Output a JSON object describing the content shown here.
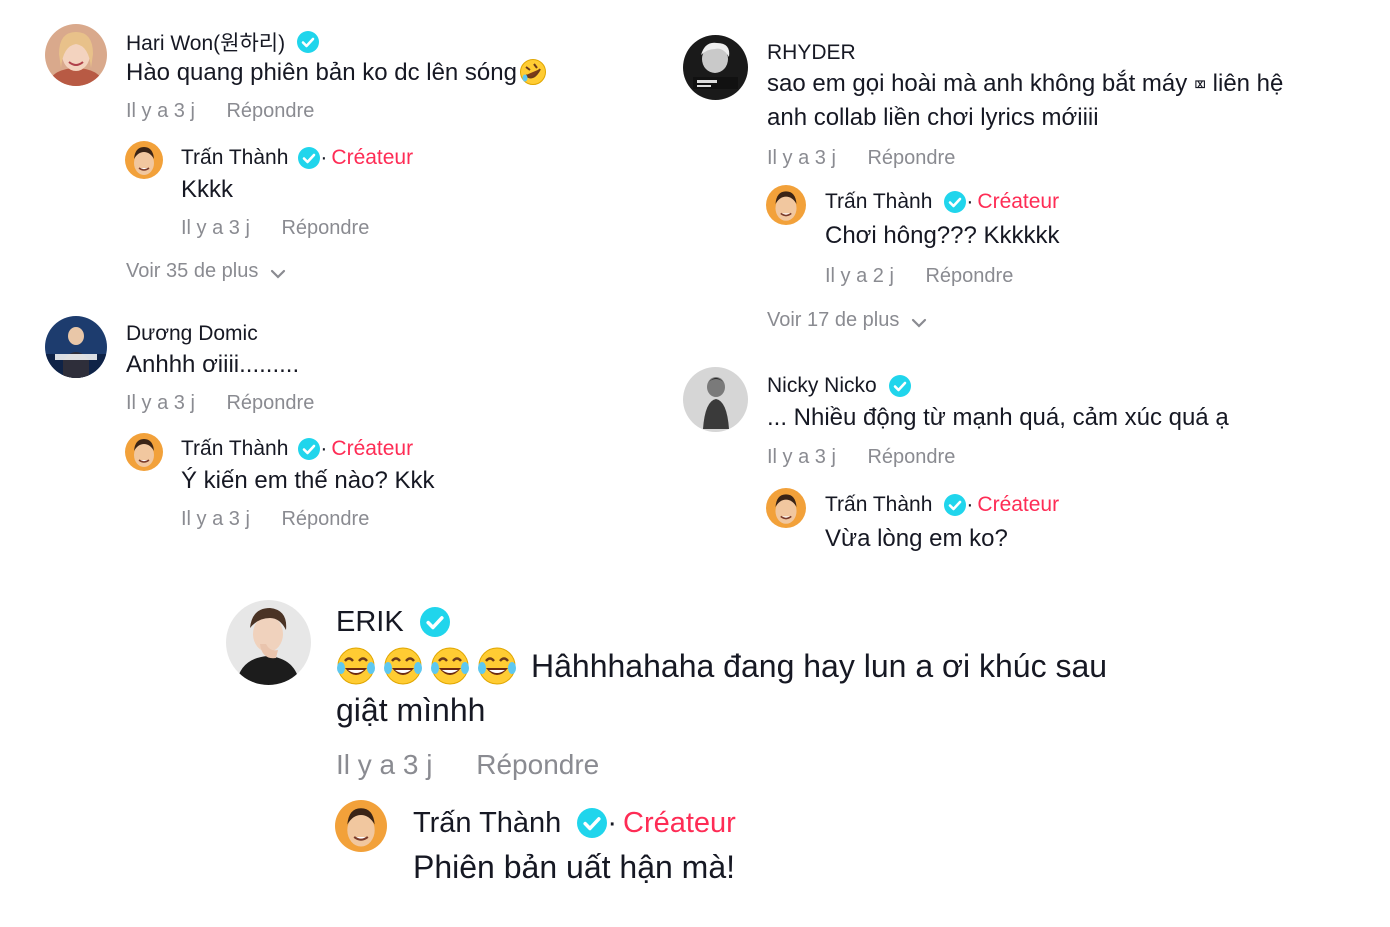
{
  "labels": {
    "creator": "Créateur",
    "reply": "Répondre",
    "dot": "·"
  },
  "colors": {
    "creator": "#fe2c55",
    "verified": "#20d5ec",
    "meta": "#8a8b91",
    "text": "#161823"
  },
  "left": {
    "c1": {
      "author": "Hari Won(원하리)",
      "verified": true,
      "text": "Hào quang phiên bản ko dc lên sóng",
      "emoji": "rolling-on-floor-laughing",
      "time": "Il y a 3 j",
      "reply": {
        "author": "Trấn Thành",
        "text": "Kkkk",
        "time": "Il y a 3 j"
      },
      "more": "Voir 35 de plus"
    },
    "c2": {
      "author": "Dương Domic",
      "verified": false,
      "text": "Anhhh ơiiii.........",
      "time": "Il y a 3 j",
      "reply": {
        "author": "Trấn Thành",
        "text": "Ý kiến em thế nào? Kkk",
        "time": "Il y a 3 j"
      }
    }
  },
  "right": {
    "c1": {
      "author": "RHYDER",
      "verified": false,
      "text_line1": "sao em gọi hoài mà anh không bắt máy",
      "missing_glyph": "⌧",
      "text_line1b": "liên hệ",
      "text_line2": "anh collab liền chơi lyrics mớiiii",
      "time": "Il y a 3 j",
      "reply": {
        "author": "Trấn Thành",
        "text": "Chơi hông??? Kkkkkk",
        "time": "Il y a 2 j"
      },
      "more": "Voir 17 de plus"
    },
    "c2": {
      "author": "Nicky Nicko",
      "verified": true,
      "text": "... Nhiều động từ mạnh quá, cảm xúc quá ạ",
      "time": "Il y a 3 j",
      "reply": {
        "author": "Trấn Thành",
        "text": "Vừa lòng em ko?"
      }
    }
  },
  "bottom": {
    "author": "ERIK",
    "verified": true,
    "emojis": [
      "face-with-tears-of-joy",
      "face-with-tears-of-joy",
      "face-with-tears-of-joy",
      "face-with-tears-of-joy"
    ],
    "text_line1": "Hâhhhahaha đang hay lun a ơi khúc sau",
    "text_line2": "giật mìnhh",
    "time": "Il y a 3 j",
    "reply": {
      "author": "Trấn Thành",
      "text": "Phiên bản uất hận mà!"
    }
  },
  "icons": {
    "verified": "verified-badge-icon",
    "chevron": "chevron-down-icon"
  }
}
